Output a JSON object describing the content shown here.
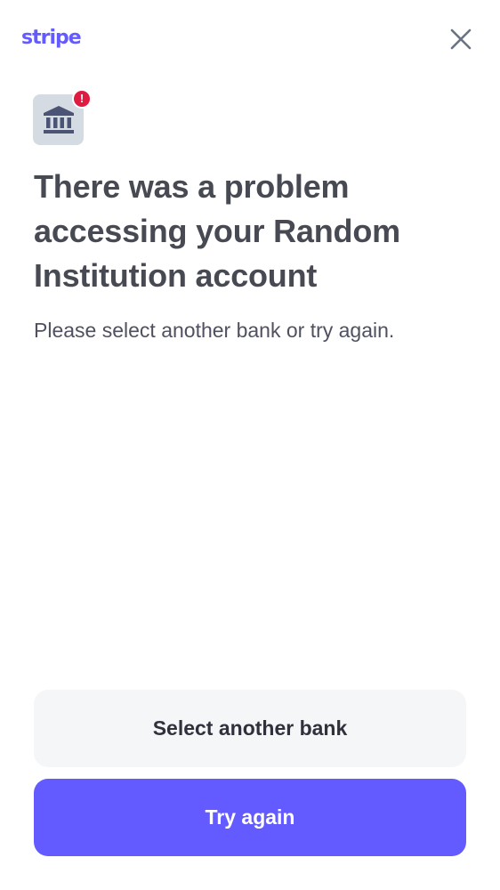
{
  "header": {
    "logo_text": "stripe",
    "close_icon": "close-icon"
  },
  "icon": {
    "name": "bank-icon",
    "alert_mark": "!"
  },
  "main": {
    "title": "There was a problem accessing your Random Institution account",
    "subtitle": "Please select another bank or try again."
  },
  "actions": {
    "secondary_label": "Select another bank",
    "primary_label": "Try again"
  },
  "colors": {
    "brand": "#635bff",
    "alert": "#df1b41",
    "icon_bg": "#d5dbe3",
    "secondary_button_bg": "#f5f6f8"
  }
}
